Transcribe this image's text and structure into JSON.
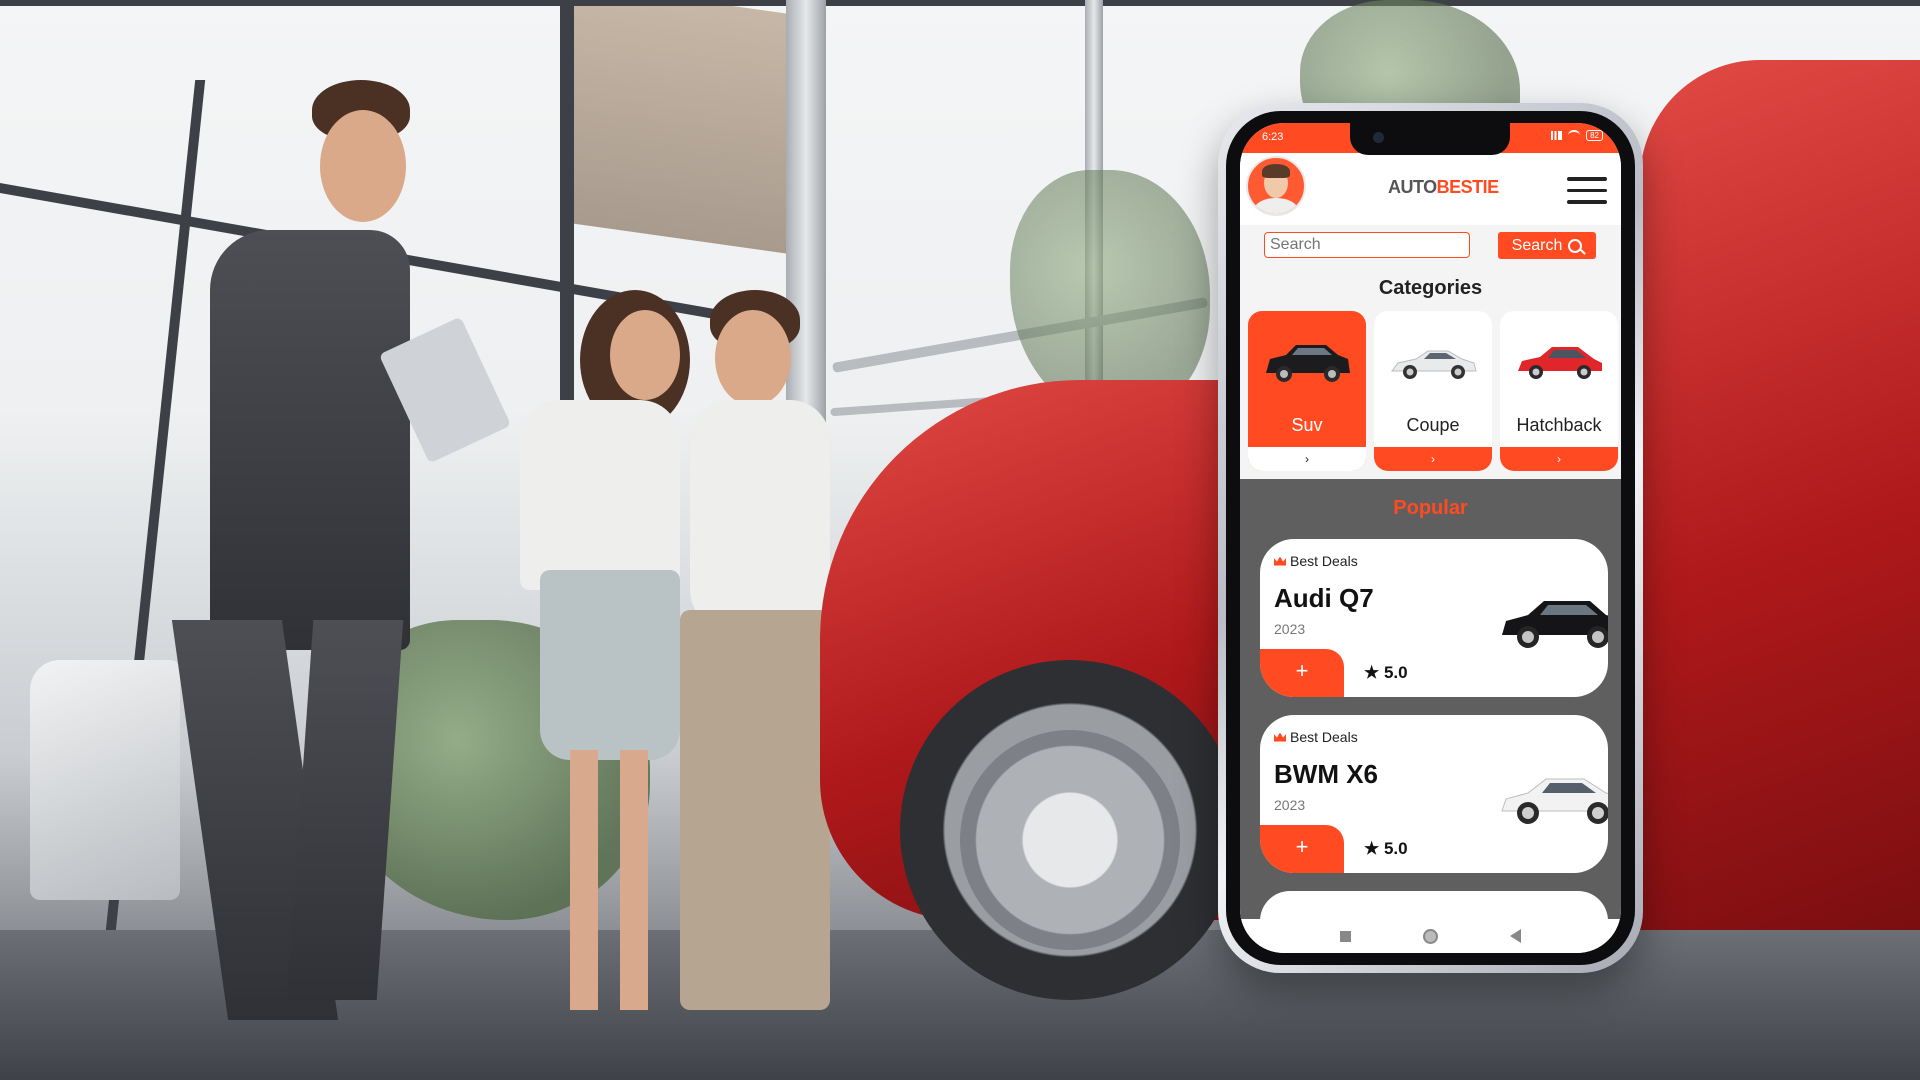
{
  "status_bar": {
    "time": "6:23",
    "battery": "82"
  },
  "app": {
    "brand_part1": "AUTO",
    "brand_part2": "BESTIE"
  },
  "search": {
    "placeholder": "Search",
    "button_label": "Search"
  },
  "categories": {
    "title": "Categories",
    "items": [
      {
        "label": "Suv",
        "arrow": "›",
        "active": true
      },
      {
        "label": "Coupe",
        "arrow": "›",
        "active": false
      },
      {
        "label": "Hatchback",
        "arrow": "›",
        "active": false
      }
    ]
  },
  "popular": {
    "title": "Popular",
    "deals": [
      {
        "badge": "Best Deals",
        "name": "Audi Q7",
        "year": "2023",
        "add_label": "+",
        "rating": "★ 5.0"
      },
      {
        "badge": "Best Deals",
        "name": "BWM X6",
        "year": "2023",
        "add_label": "+",
        "rating": "★ 5.0"
      }
    ]
  },
  "colors": {
    "accent": "#ff4a22",
    "popular_bg": "#5f5f5f",
    "brand_gray": "#555555"
  },
  "icons": [
    "avatar",
    "hamburger-menu-icon",
    "search-icon",
    "crown-icon",
    "star-icon",
    "nav-recents-icon",
    "nav-home-icon",
    "nav-back-icon"
  ]
}
